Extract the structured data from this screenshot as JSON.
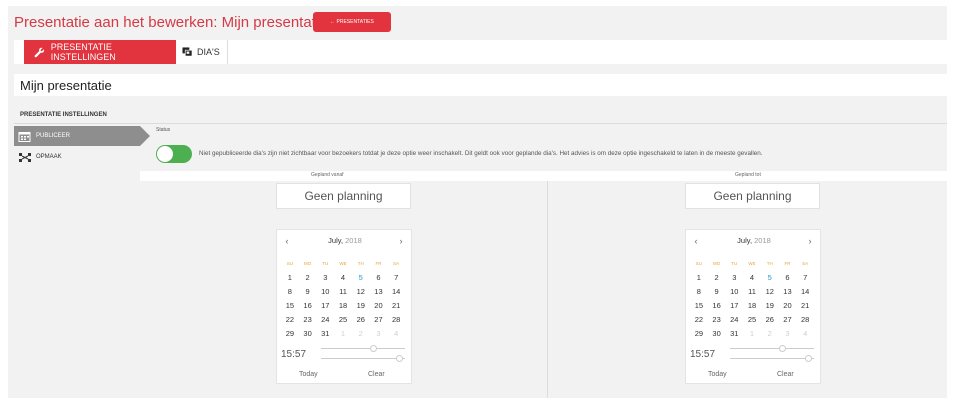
{
  "header": {
    "title": "Presentatie aan het bewerken: Mijn presentatie",
    "back_button": "← PRESENTATIES"
  },
  "tabs": [
    {
      "label": "PRESENTATIE INSTELLINGEN",
      "icon": "wrench-icon",
      "active": true
    },
    {
      "label": "DIA'S",
      "icon": "slides-icon",
      "active": false
    }
  ],
  "presentation_name": "Mijn presentatie",
  "section_title": "PRESENTATIE INSTELLINGEN",
  "sidebar": {
    "items": [
      {
        "label": "PUBLICEER",
        "icon": "calendar-icon",
        "active": true
      },
      {
        "label": "OPMAAK",
        "icon": "layout-icon",
        "active": false
      }
    ]
  },
  "status": {
    "label": "Status",
    "published": true,
    "text": "Niet gepubliceerde dia's zijn niet zichtbaar voor bezoekers totdat je deze optie weer inschakelt. Dit geldt ook voor geplande dia's. Het advies is om deze optie ingeschakeld te laten in de meeste gevallen."
  },
  "schedule": {
    "from_label": "Gepland vanaf",
    "to_label": "Gepland tot",
    "from_value": "Geen planning",
    "to_value": "Geen planning"
  },
  "calendar": {
    "month": "July,",
    "year": "2018",
    "weekdays": [
      "SU",
      "MO",
      "TU",
      "WE",
      "TH",
      "FR",
      "SA"
    ],
    "weeks": [
      [
        "1",
        "2",
        "3",
        "4",
        "5",
        "6",
        "7"
      ],
      [
        "8",
        "9",
        "10",
        "11",
        "12",
        "13",
        "14"
      ],
      [
        "15",
        "16",
        "17",
        "18",
        "19",
        "20",
        "21"
      ],
      [
        "22",
        "23",
        "24",
        "25",
        "26",
        "27",
        "28"
      ],
      [
        "29",
        "30",
        "31",
        "1",
        "2",
        "3",
        "4"
      ]
    ],
    "today": "5",
    "time": "15:57",
    "today_button": "Today",
    "clear_button": "Clear",
    "accent_color": "#2a9bd6"
  },
  "colors": {
    "brand_red": "#e2343f",
    "toggle_green": "#4caf50",
    "weekday_orange": "#e8a33a"
  }
}
